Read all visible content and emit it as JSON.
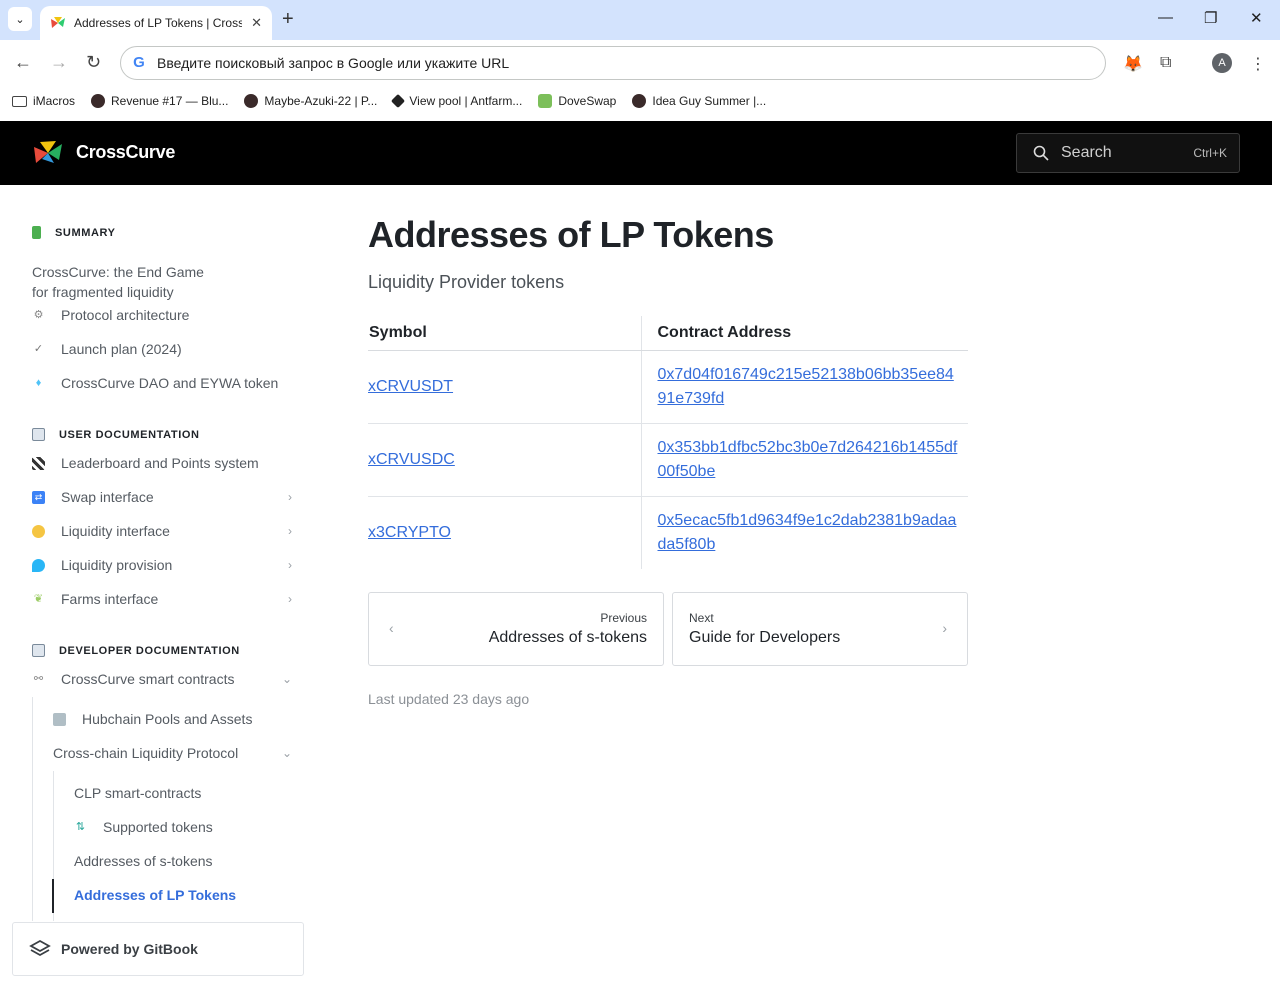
{
  "browser": {
    "tab_title": "Addresses of LP Tokens | CrossCurve",
    "omnibox_placeholder": "Введите поисковый запрос в Google или укажите URL",
    "avatar_letter": "A",
    "bookmarks": [
      {
        "label": "iMacros",
        "icon": "folder-icon"
      },
      {
        "label": "Revenue #17 — Blu...",
        "icon": "site-icon"
      },
      {
        "label": "Maybe-Azuki-22 | P...",
        "icon": "site-icon"
      },
      {
        "label": "View pool | Antfarm...",
        "icon": "site-icon"
      },
      {
        "label": "DoveSwap",
        "icon": "site-icon"
      },
      {
        "label": "Idea Guy Summer |...",
        "icon": "site-icon"
      }
    ]
  },
  "header": {
    "logo_text": "CrossCurve",
    "search_placeholder": "Search",
    "search_shortcut": "Ctrl+K"
  },
  "sidebar": {
    "summary_title": "SUMMARY",
    "summary_items": {
      "end_game_line1": "CrossCurve: the End Game",
      "end_game_line2": "for fragmented liquidity",
      "protocol": "Protocol architecture",
      "launch": "Launch plan (2024)",
      "dao": "CrossCurve DAO and EYWA token"
    },
    "user_title": "USER DOCUMENTATION",
    "user_items": {
      "leaderboard": "Leaderboard and Points system",
      "swap": "Swap interface",
      "liquidity_interface": "Liquidity interface",
      "liquidity_provision": "Liquidity provision",
      "farms": "Farms interface"
    },
    "dev_title": "DEVELOPER DOCUMENTATION",
    "dev_items": {
      "smart_contracts": "CrossCurve smart contracts",
      "hubchain": "Hubchain Pools and Assets",
      "clp": "Cross-chain Liquidity Protocol",
      "clp_contracts": "CLP smart-contracts",
      "supported": "Supported tokens",
      "s_tokens": "Addresses of s-tokens",
      "lp_tokens": "Addresses of LP Tokens"
    },
    "powered": "Powered by GitBook"
  },
  "main": {
    "title": "Addresses of LP Tokens",
    "subtitle": "Liquidity Provider tokens",
    "table": {
      "headers": [
        "Symbol",
        "Contract Address"
      ],
      "rows": [
        {
          "symbol": "xCRVUSDT",
          "address": "0x7d04f016749c215e52138b06bb35ee8491e739fd"
        },
        {
          "symbol": "xCRVUSDC",
          "address": "0x353bb1dfbc52bc3b0e7d264216b1455df00f50be"
        },
        {
          "symbol": "x3CRYPTO",
          "address": "0x5ecac5fb1d9634f9e1c2dab2381b9adaada5f80b"
        }
      ]
    },
    "previous_label": "Previous",
    "previous_title": "Addresses of s-tokens",
    "next_label": "Next",
    "next_title": "Guide for Developers",
    "last_updated": "Last updated 23 days ago"
  }
}
